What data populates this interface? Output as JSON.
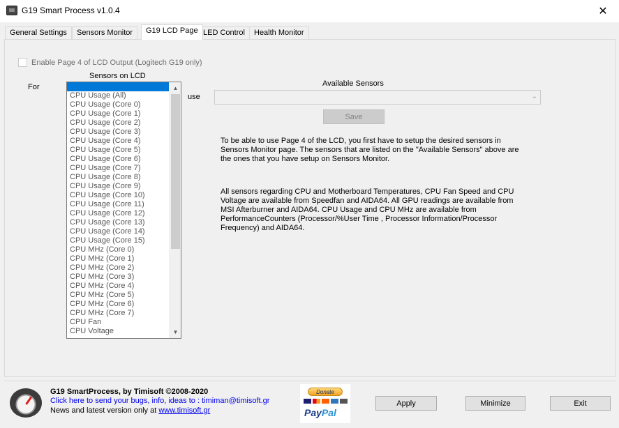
{
  "window": {
    "title": "G19 Smart Process v1.0.4",
    "close_glyph": "✕"
  },
  "tabs": [
    {
      "label": "General Settings",
      "active": false
    },
    {
      "label": "Sensors Monitor",
      "active": false
    },
    {
      "label": "G19 LCD Page",
      "active": true
    },
    {
      "label": "LED Control",
      "active": false
    },
    {
      "label": "Health Monitor",
      "active": false
    }
  ],
  "lcd": {
    "enable_label": "Enable Page 4 of LCD Output (Logitech G19 only)",
    "sensors_on_lcd_label": "Sensors on LCD",
    "for_label": "For",
    "use_label": "use",
    "available_sensors_label": "Available Sensors",
    "available_sensors_value": "",
    "save_label": "Save",
    "list_items": [
      "",
      "CPU Usage (All)",
      "CPU Usage (Core 0)",
      "CPU Usage (Core 1)",
      "CPU Usage (Core 2)",
      "CPU Usage (Core 3)",
      "CPU Usage (Core 4)",
      "CPU Usage (Core 5)",
      "CPU Usage (Core 6)",
      "CPU Usage (Core 7)",
      "CPU Usage (Core 8)",
      "CPU Usage (Core 9)",
      "CPU Usage (Core 10)",
      "CPU Usage (Core 11)",
      "CPU Usage (Core 12)",
      "CPU Usage (Core 13)",
      "CPU Usage (Core 14)",
      "CPU Usage (Core 15)",
      "CPU MHz (Core 0)",
      "CPU MHz (Core 1)",
      "CPU MHz (Core 2)",
      "CPU MHz (Core 3)",
      "CPU MHz (Core 4)",
      "CPU MHz (Core 5)",
      "CPU MHz (Core 6)",
      "CPU MHz (Core 7)",
      "CPU Fan",
      "CPU Voltage"
    ],
    "selected_index": 0,
    "info1": [
      "To be able to use Page 4 of the LCD, you first have to setup the desired sensors in",
      "Sensors Monitor page. The sensors that are listed on the \"Available Sensors\" above are",
      "the ones that you have setup on Sensors Monitor."
    ],
    "info2": [
      "All sensors regarding CPU and Motherboard Temperatures, CPU Fan Speed and CPU",
      "Voltage are available from Speedfan and AIDA64. All GPU readings are available from",
      "MSI Afterburner and AIDA64. CPU Usage and CPU MHz are available from",
      "PerformanceCounters (Processor/%User Time , Processor Information/Processor",
      "Frequency) and AIDA64."
    ]
  },
  "footer": {
    "title": "G19 SmartProcess, by Timisoft ©2008-2020",
    "bug_link": "Click here to send your bugs, info, ideas to : timiman@timisoft.gr",
    "news_text": "News and latest version only at ",
    "news_link": "www.timisoft.gr",
    "donate_label": "Donate",
    "paypal_pay": "Pay",
    "paypal_pal": "Pal",
    "apply_label": "Apply",
    "minimize_label": "Minimize",
    "exit_label": "Exit"
  },
  "colors": {
    "selection": "#0078d7",
    "link": "#0000ee",
    "paypal_dark": "#1c3b8a",
    "paypal_light": "#2790d6"
  }
}
